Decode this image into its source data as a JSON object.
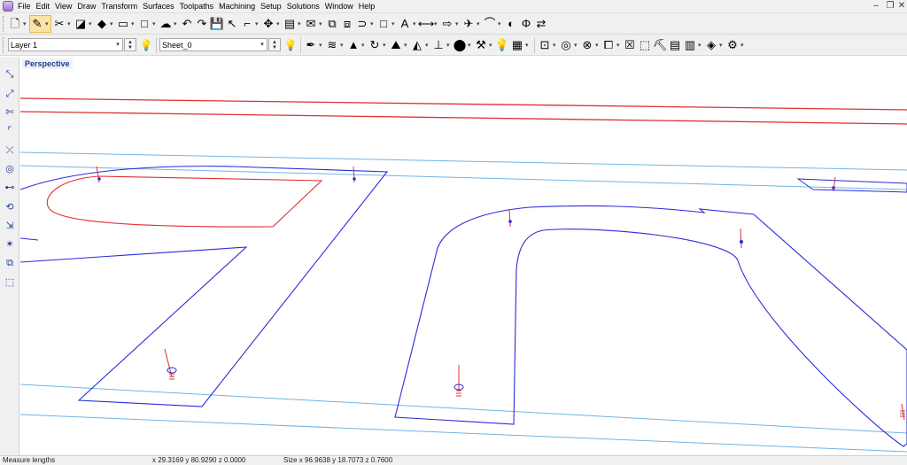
{
  "menubar": {
    "items": [
      "File",
      "Edit",
      "View",
      "Draw",
      "Transform",
      "Surfaces",
      "Toolpaths",
      "Machining",
      "Setup",
      "Solutions",
      "Window",
      "Help"
    ]
  },
  "toolbar1": {
    "icons": [
      {
        "name": "new-file-icon",
        "glyph": "🗋",
        "dd": true
      },
      {
        "name": "pencil-draw-icon",
        "glyph": "✎",
        "dd": true,
        "active": true
      },
      {
        "name": "scissors-icon",
        "glyph": "✂",
        "dd": true
      },
      {
        "name": "select-surface-icon",
        "glyph": "◪",
        "dd": true
      },
      {
        "name": "layers-icon",
        "glyph": "◆",
        "dd": true
      },
      {
        "name": "shape-edit-icon",
        "glyph": "▭",
        "dd": true
      },
      {
        "name": "rectangle-icon",
        "glyph": "□",
        "dd": true
      },
      {
        "name": "cloud-icon",
        "glyph": "☁",
        "dd": true
      },
      {
        "name": "undo-icon",
        "glyph": "↶",
        "dd": false
      },
      {
        "name": "redo-icon",
        "glyph": "↷",
        "dd": false
      },
      {
        "name": "save-icon",
        "glyph": "💾",
        "dd": false
      },
      {
        "name": "pointer-icon",
        "glyph": "↖",
        "dd": false
      },
      {
        "name": "node-edit-icon",
        "glyph": "⌐",
        "dd": true
      },
      {
        "name": "transform-icon",
        "glyph": "✥",
        "dd": true
      },
      {
        "name": "stack-icon",
        "glyph": "▤",
        "dd": true
      },
      {
        "name": "envelope-icon",
        "glyph": "✉",
        "dd": true
      },
      {
        "name": "combine-icon",
        "glyph": "⧉",
        "dd": false
      },
      {
        "name": "boolean-icon",
        "glyph": "⧈",
        "dd": false
      },
      {
        "name": "offset-curve-icon",
        "glyph": "⊃",
        "dd": true
      },
      {
        "name": "square-icon",
        "glyph": "□",
        "dd": true
      },
      {
        "name": "text-icon",
        "glyph": "A",
        "dd": true
      },
      {
        "name": "fit-text-icon",
        "glyph": "⟷",
        "dd": true
      },
      {
        "name": "arrow-right-icon",
        "glyph": "⇨",
        "dd": true
      },
      {
        "name": "align-icon",
        "glyph": "✈",
        "dd": true
      },
      {
        "name": "curve-icon",
        "glyph": "⌒",
        "dd": true
      },
      {
        "name": "mirror-icon",
        "glyph": "◐",
        "dd": false
      },
      {
        "name": "symmetry-icon",
        "glyph": "Φ",
        "dd": false
      },
      {
        "name": "swap-icon",
        "glyph": "⇄",
        "dd": false
      }
    ]
  },
  "toolbar2": {
    "layer_value": "Layer 1",
    "sheet_value": "Sheet_0",
    "icons_a": [
      {
        "name": "feather-icon",
        "glyph": "✒",
        "dd": true
      },
      {
        "name": "sweep-icon",
        "glyph": "≋",
        "dd": true
      },
      {
        "name": "pyramid-icon",
        "glyph": "▲",
        "dd": true
      },
      {
        "name": "revolve-icon",
        "glyph": "↻",
        "dd": true
      },
      {
        "name": "extrude-icon",
        "glyph": "⛰",
        "dd": true
      },
      {
        "name": "bevel-icon",
        "glyph": "◭",
        "dd": true
      },
      {
        "name": "lathe-icon",
        "glyph": "⊥",
        "dd": true
      },
      {
        "name": "dome-icon",
        "glyph": "⬤",
        "dd": true
      },
      {
        "name": "sculpt-icon",
        "glyph": "⚒",
        "dd": true
      },
      {
        "name": "light-bulb-icon",
        "glyph": "💡",
        "dd": false
      },
      {
        "name": "texture-icon",
        "glyph": "▦",
        "dd": true
      }
    ],
    "icons_b": [
      {
        "name": "frame-icon",
        "glyph": "⊡",
        "dd": true
      },
      {
        "name": "target-icon",
        "glyph": "◎",
        "dd": true
      },
      {
        "name": "circle-cross-icon",
        "glyph": "⊗",
        "dd": true
      },
      {
        "name": "copy-frame-icon",
        "glyph": "⧠",
        "dd": true
      },
      {
        "name": "delete-x-icon",
        "glyph": "☒",
        "dd": false
      },
      {
        "name": "machine-icon",
        "glyph": "⬚",
        "dd": false
      },
      {
        "name": "tool-icon",
        "glyph": "⛏",
        "dd": false
      },
      {
        "name": "toolpath-list-icon",
        "glyph": "▤",
        "dd": false
      },
      {
        "name": "layout-icon",
        "glyph": "▥",
        "dd": true
      },
      {
        "name": "material-icon",
        "glyph": "◈",
        "dd": true
      },
      {
        "name": "settings-icon",
        "glyph": "⚙",
        "dd": true
      }
    ]
  },
  "viewport": {
    "label": "Perspective"
  },
  "statusbar": {
    "hint": "Measure lengths",
    "coords": "x 29.3169 y 80.9290 z 0.0000",
    "size": "Size x 96.9638 y 18.7073 z 0.7600"
  },
  "colors": {
    "shape_blue": "#2b2bd9",
    "selected_red": "#e03030",
    "guide_light_blue": "#6fb4e6",
    "rail_red": "#e03030",
    "label_blue": "#1a3d8f"
  }
}
